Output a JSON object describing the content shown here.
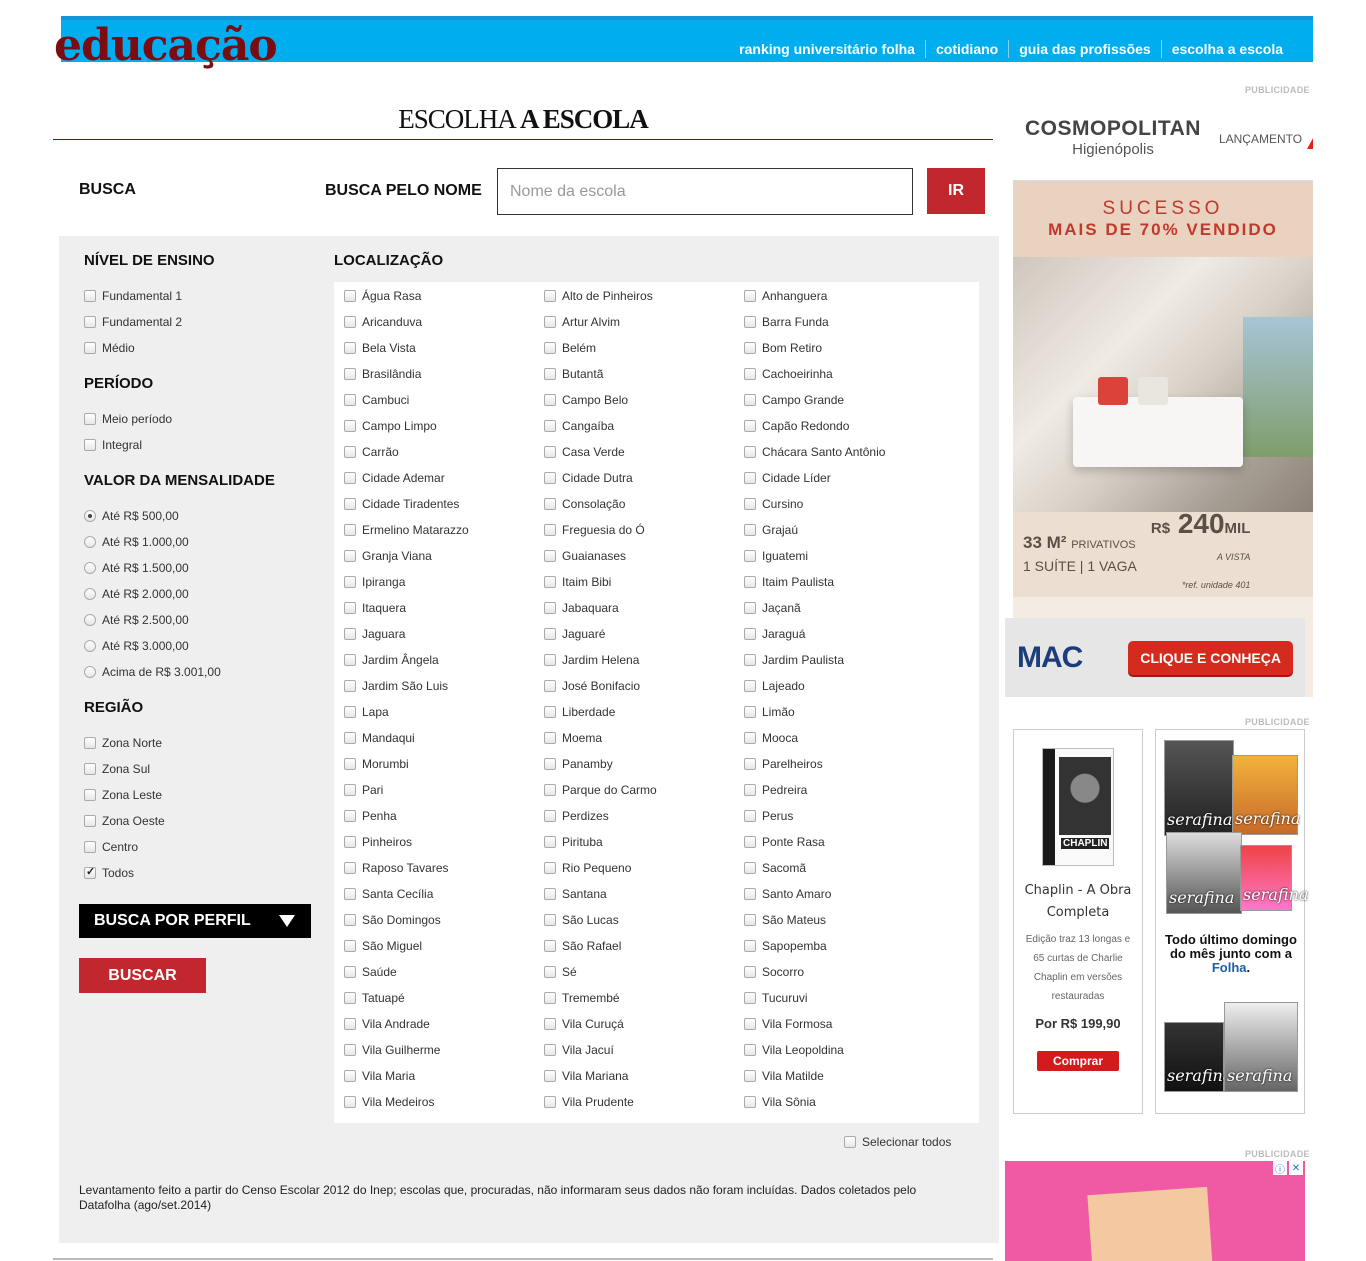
{
  "header": {
    "brand": "educação",
    "nav": [
      "ranking universitário folha",
      "cotidiano",
      "guia das profissões",
      "escolha a escola"
    ]
  },
  "section_title": {
    "light": "ESCOLHA ",
    "bold": "A ESCOLA"
  },
  "search": {
    "busca_label": "BUSCA",
    "name_label": "BUSCA PELO NOME",
    "placeholder": "Nome da escola",
    "submit": "IR"
  },
  "filters": {
    "nivel": {
      "title": "NÍVEL DE ENSINO",
      "options": [
        "Fundamental 1",
        "Fundamental 2",
        "Médio"
      ]
    },
    "periodo": {
      "title": "PERÍODO",
      "options": [
        "Meio período",
        "Integral"
      ]
    },
    "mensalidade": {
      "title": "VALOR DA MENSALIDADE",
      "selected_index": 0,
      "options": [
        "Até R$ 500,00",
        "Até R$ 1.000,00",
        "Até R$ 1.500,00",
        "Até R$ 2.000,00",
        "Até R$ 2.500,00",
        "Até R$ 3.000,00",
        "Acima de R$ 3.001,00"
      ]
    },
    "regiao": {
      "title": "REGIÃO",
      "checked_index": 5,
      "options": [
        "Zona Norte",
        "Zona Sul",
        "Zona Leste",
        "Zona Oeste",
        "Centro",
        "Todos"
      ]
    },
    "perfil_button": "BUSCA POR PERFIL",
    "buscar_button": "BUSCAR"
  },
  "localizacao": {
    "title": "LOCALIZAÇÃO",
    "columns": [
      [
        "Água Rasa",
        "Aricanduva",
        "Bela Vista",
        "Brasilândia",
        "Cambuci",
        "Campo Limpo",
        "Carrão",
        "Cidade Ademar",
        "Cidade Tiradentes",
        "Ermelino Matarazzo",
        "Granja Viana",
        "Ipiranga",
        "Itaquera",
        "Jaguara",
        "Jardim Ângela",
        "Jardim São Luis",
        "Lapa",
        "Mandaqui",
        "Morumbi",
        "Pari",
        "Penha",
        "Pinheiros",
        "Raposo Tavares",
        "Santa Cecília",
        "São Domingos",
        "São Miguel",
        "Saúde",
        "Tatuapé",
        "Vila Andrade",
        "Vila Guilherme",
        "Vila Maria",
        "Vila Medeiros"
      ],
      [
        "Alto de Pinheiros",
        "Artur Alvim",
        "Belém",
        "Butantã",
        "Campo Belo",
        "Cangaíba",
        "Casa Verde",
        "Cidade Dutra",
        "Consolação",
        "Freguesia do Ó",
        "Guaianases",
        "Itaim Bibi",
        "Jabaquara",
        "Jaguaré",
        "Jardim Helena",
        "José Bonifacio",
        "Liberdade",
        "Moema",
        "Panamby",
        "Parque do Carmo",
        "Perdizes",
        "Pirituba",
        "Rio Pequeno",
        "Santana",
        "São Lucas",
        "São Rafael",
        "Sé",
        "Tremembé",
        "Vila Curuçá",
        "Vila Jacuí",
        "Vila Mariana",
        "Vila Prudente"
      ],
      [
        "Anhanguera",
        "Barra Funda",
        "Bom Retiro",
        "Cachoeirinha",
        "Campo Grande",
        "Capão Redondo",
        "Chácara Santo Antônio",
        "Cidade Líder",
        "Cursino",
        "Grajaú",
        "Iguatemi",
        "Itaim Paulista",
        "Jaçanã",
        "Jaraguá",
        "Jardim Paulista",
        "Lajeado",
        "Limão",
        "Mooca",
        "Parelheiros",
        "Pedreira",
        "Perus",
        "Ponte Rasa",
        "Sacomã",
        "Santo Amaro",
        "São Mateus",
        "Sapopemba",
        "Socorro",
        "Tucuruvi",
        "Vila Formosa",
        "Vila Leopoldina",
        "Vila Matilde",
        "Vila Sônia"
      ]
    ],
    "select_all": "Selecionar todos"
  },
  "note": "Levantamento feito a partir do Censo Escolar 2012 do Inep; escolas que, procuradas, não informaram seus dados não foram incluídas. Dados coletados pelo Datafolha (ago/set.2014)",
  "ads": {
    "label": "PUBLICIDADE",
    "cosmo": {
      "brand": "COSMOPOLITAN",
      "sub": "Higienópolis",
      "launch": "LANÇAMENTO",
      "line1": "SUCESSO",
      "line2": "MAIS DE 70% VENDIDO",
      "area": "33 M²",
      "area_unit": "PRIVATIVOS",
      "rooms": "1 SUÍTE | 1 VAGA",
      "price_prefix": "R$",
      "price": "240",
      "price_suffix": "MIL",
      "price_note": "A VISTA",
      "price_ref": "*ref. unidade 401",
      "mac": "MAC",
      "cta": "CLIQUE E CONHEÇA"
    },
    "chaplin": {
      "dvd_text": "CHAPLIN",
      "title": "Chaplin - A Obra Completa",
      "desc": "Edição traz 13 longas e 65 curtas de Charlie Chaplin em versões restauradas",
      "price": "Por R$ 199,90",
      "button": "Comprar"
    },
    "serafina": {
      "mag_label": "serafina",
      "text_before": "Todo último domingo do mês junto com a ",
      "text_brand": "Folha",
      "text_after": "."
    }
  }
}
